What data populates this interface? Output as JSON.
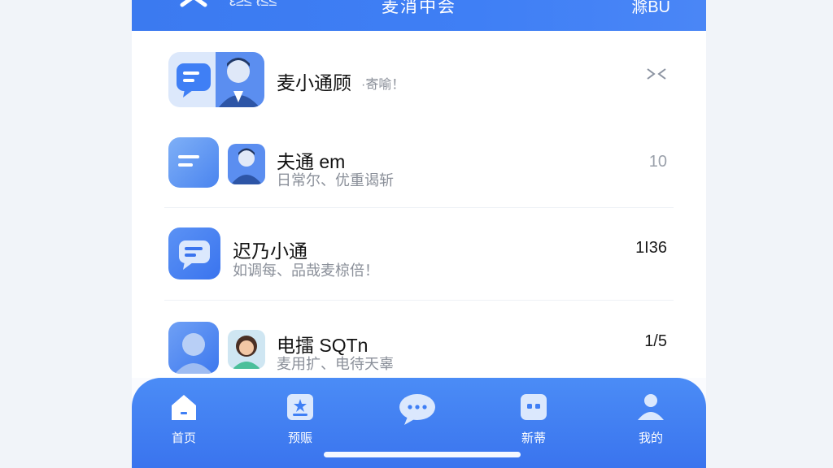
{
  "header": {
    "left_text": "ε≥≤ ℓ≤≤",
    "title": "麦消中会",
    "right_text": "滁BU"
  },
  "conversations": [
    {
      "name": "麦小通顾",
      "preview": "·寄喻！",
      "time": ""
    },
    {
      "name": "夫通 em",
      "preview": "日常尔、优重谒斩",
      "time": "10"
    },
    {
      "name": "迟乃小通",
      "preview": "如调每、品哉麦椋倍！",
      "time": "1I36"
    },
    {
      "name": "电擂 SQTn",
      "preview": "麦用扩、电待天辜",
      "time": "1/5"
    }
  ],
  "tabs": [
    {
      "label": "首页",
      "icon": "home-icon"
    },
    {
      "label": "预赈",
      "icon": "bookmark-icon"
    },
    {
      "label": "",
      "icon": "chat-icon"
    },
    {
      "label": "新蒂",
      "icon": "apps-icon"
    },
    {
      "label": "我的",
      "icon": "profile-icon"
    }
  ],
  "colors": {
    "accent": "#3d7cf2",
    "header": "#3f7ff5",
    "tabbar": "#4285f4"
  }
}
